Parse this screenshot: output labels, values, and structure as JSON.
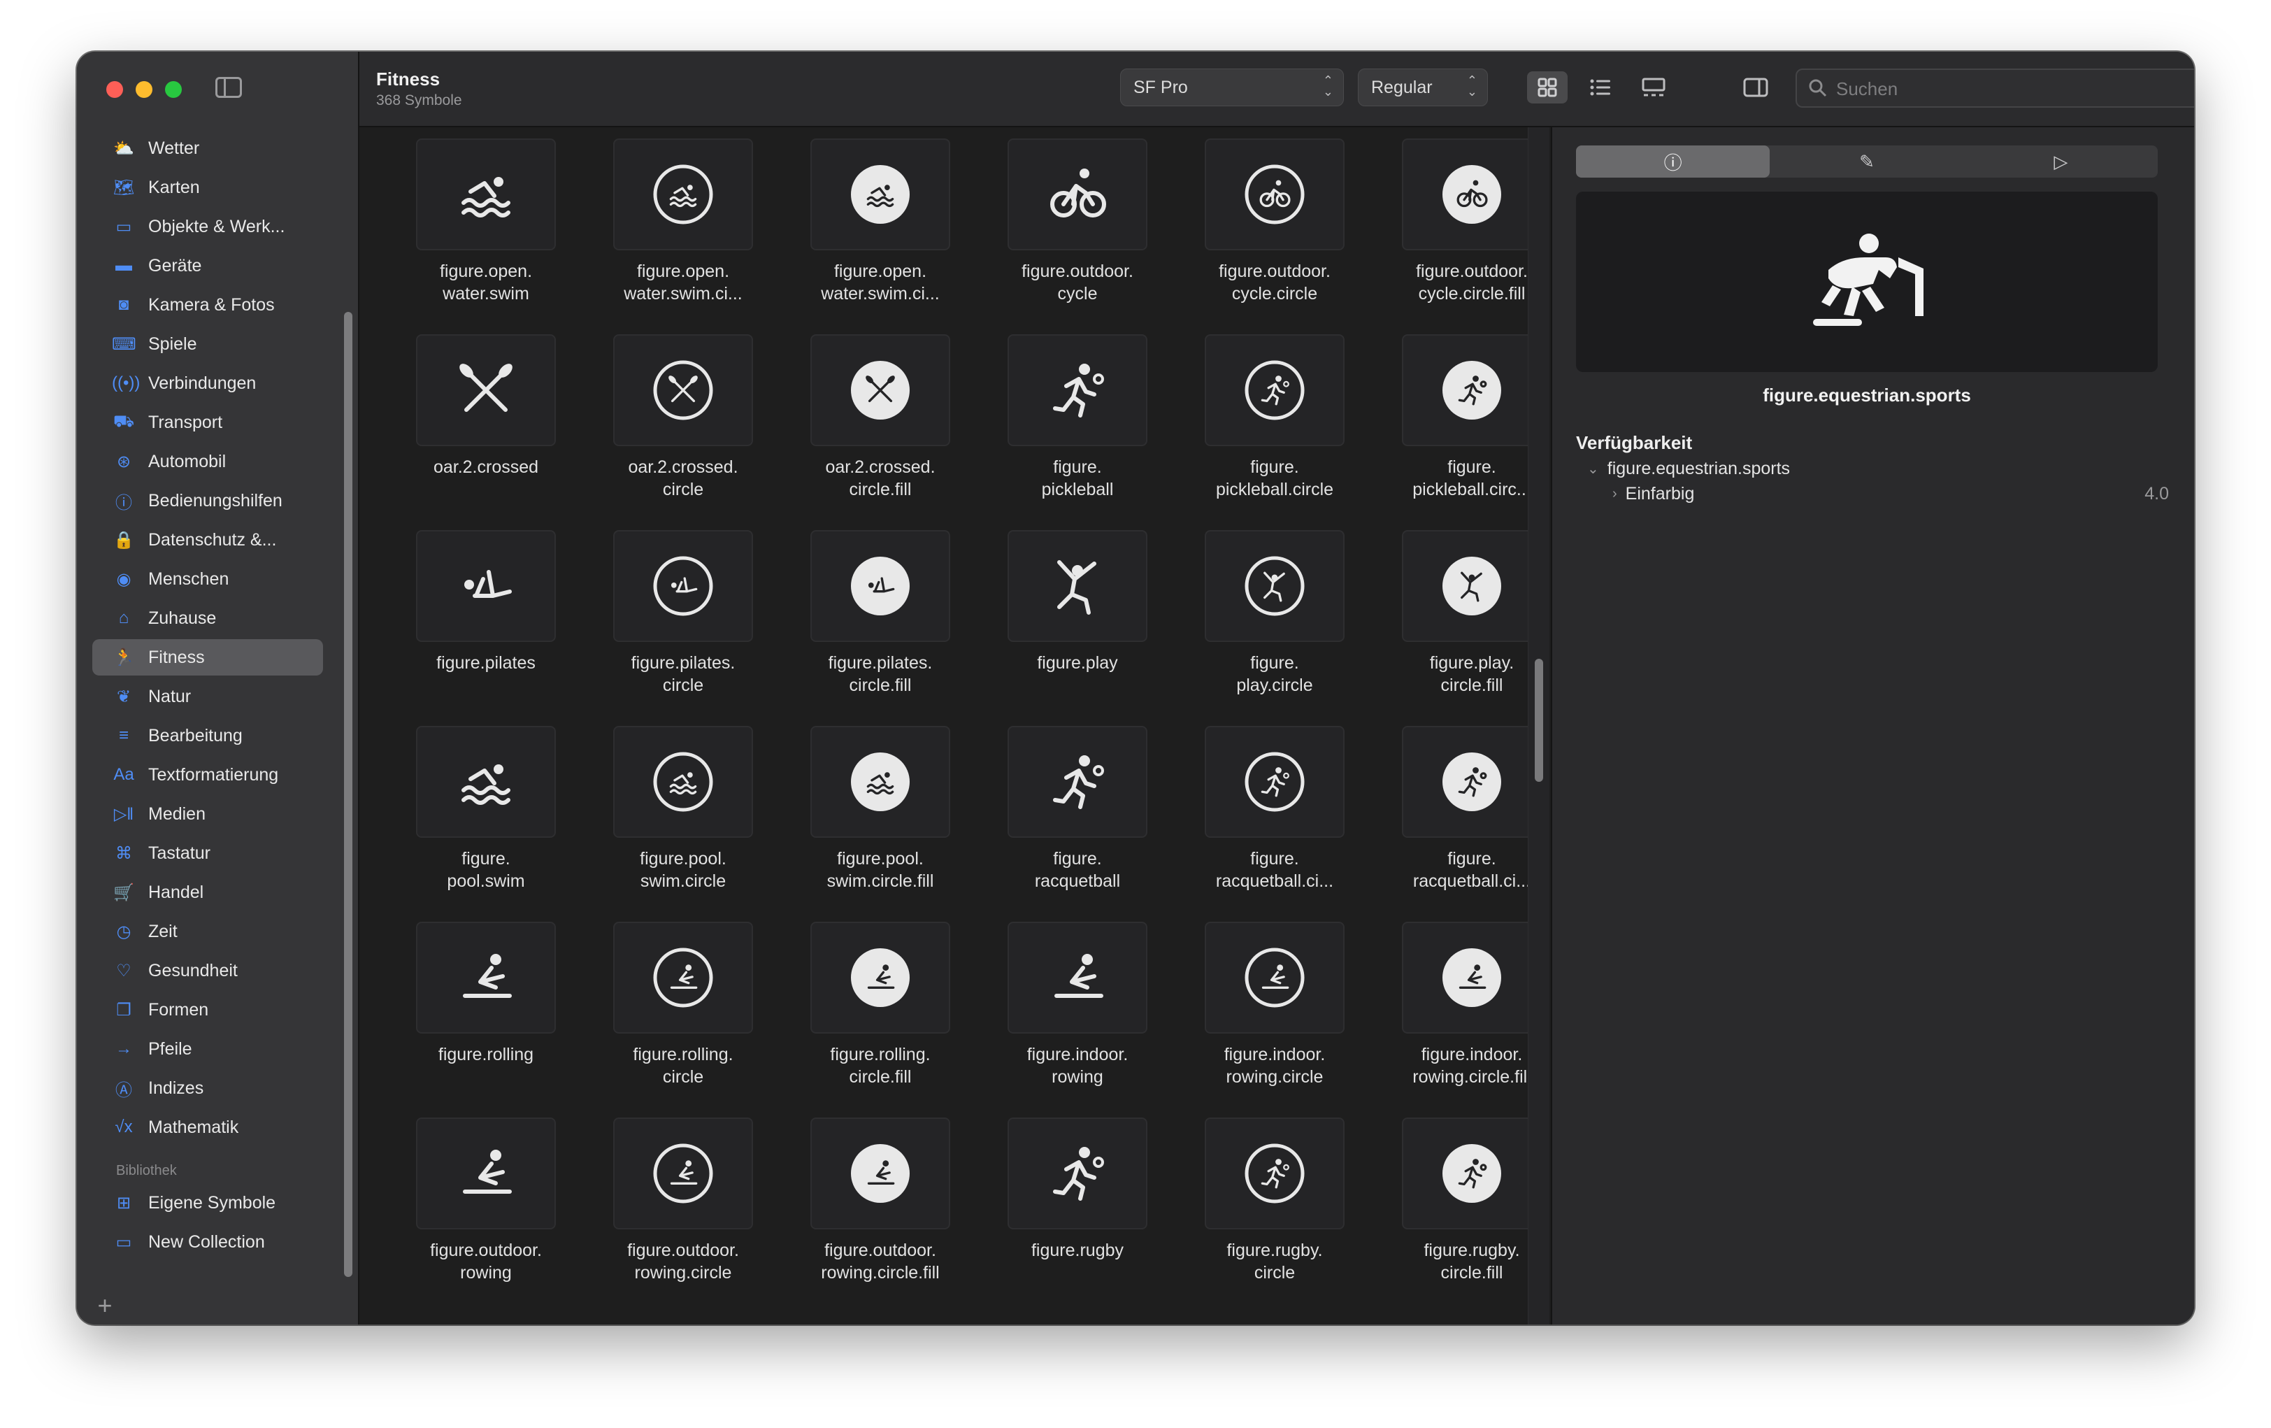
{
  "sidebar": {
    "items": [
      {
        "label": "Wetter",
        "icon": "cloud-sun-icon",
        "glyph": "⛅"
      },
      {
        "label": "Karten",
        "icon": "map-icon",
        "glyph": "🗺"
      },
      {
        "label": "Objekte & Werk...",
        "icon": "folder-icon",
        "glyph": "▭"
      },
      {
        "label": "Geräte",
        "icon": "display-icon",
        "glyph": "▬"
      },
      {
        "label": "Kamera & Fotos",
        "icon": "camera-icon",
        "glyph": "◙"
      },
      {
        "label": "Spiele",
        "icon": "gamecontroller-icon",
        "glyph": "⌨"
      },
      {
        "label": "Verbindungen",
        "icon": "antenna-icon",
        "glyph": "((•))"
      },
      {
        "label": "Transport",
        "icon": "car-icon",
        "glyph": "⛟"
      },
      {
        "label": "Automobil",
        "icon": "steering-wheel-icon",
        "glyph": "⊛"
      },
      {
        "label": "Bedienungshilfen",
        "icon": "accessibility-icon",
        "glyph": "ⓘ"
      },
      {
        "label": "Datenschutz &...",
        "icon": "lock-icon",
        "glyph": "🔒"
      },
      {
        "label": "Menschen",
        "icon": "person-circle-icon",
        "glyph": "◉"
      },
      {
        "label": "Zuhause",
        "icon": "house-icon",
        "glyph": "⌂"
      },
      {
        "label": "Fitness",
        "icon": "figure-run-icon",
        "glyph": "🏃",
        "active": true
      },
      {
        "label": "Natur",
        "icon": "leaf-icon",
        "glyph": "❦"
      },
      {
        "label": "Bearbeitung",
        "icon": "sliders-icon",
        "glyph": "≡"
      },
      {
        "label": "Textformatierung",
        "icon": "textformat-icon",
        "glyph": "Aa"
      },
      {
        "label": "Medien",
        "icon": "playpause-icon",
        "glyph": "▷‖"
      },
      {
        "label": "Tastatur",
        "icon": "command-icon",
        "glyph": "⌘"
      },
      {
        "label": "Handel",
        "icon": "cart-icon",
        "glyph": "🛒"
      },
      {
        "label": "Zeit",
        "icon": "clock-icon",
        "glyph": "◷"
      },
      {
        "label": "Gesundheit",
        "icon": "heart-icon",
        "glyph": "♡"
      },
      {
        "label": "Formen",
        "icon": "square-on-square-icon",
        "glyph": "❐"
      },
      {
        "label": "Pfeile",
        "icon": "arrow-right-icon",
        "glyph": "→"
      },
      {
        "label": "Indizes",
        "icon": "a-circle-icon",
        "glyph": "Ⓐ"
      },
      {
        "label": "Mathematik",
        "icon": "function-icon",
        "glyph": "√x"
      }
    ],
    "library_title": "Bibliothek",
    "library_items": [
      {
        "label": "Eigene Symbole",
        "icon": "square-grid-icon",
        "glyph": "⊞"
      },
      {
        "label": "New Collection",
        "icon": "folder-icon",
        "glyph": "▭"
      }
    ],
    "add_label": "+"
  },
  "toolbar": {
    "title": "Fitness",
    "subtitle": "368 Symbole",
    "font_popup": "SF Pro",
    "weight_popup": "Regular",
    "search_placeholder": "Suchen"
  },
  "symbols": [
    {
      "label": "figure.open.\nwater.swim",
      "kind": "swim",
      "variant": "plain"
    },
    {
      "label": "figure.open.\nwater.swim.ci...",
      "kind": "swim",
      "variant": "circle"
    },
    {
      "label": "figure.open.\nwater.swim.ci...",
      "kind": "swim",
      "variant": "fill"
    },
    {
      "label": "figure.outdoor.\ncycle",
      "kind": "cycle",
      "variant": "plain"
    },
    {
      "label": "figure.outdoor.\ncycle.circle",
      "kind": "cycle",
      "variant": "circle"
    },
    {
      "label": "figure.outdoor.\ncycle.circle.fill",
      "kind": "cycle",
      "variant": "fill"
    },
    {
      "label": "oar.2.crossed",
      "kind": "oars",
      "variant": "plain"
    },
    {
      "label": "oar.2.crossed.\ncircle",
      "kind": "oars",
      "variant": "circle"
    },
    {
      "label": "oar.2.crossed.\ncircle.fill",
      "kind": "oars",
      "variant": "fill"
    },
    {
      "label": "figure.\npickleball",
      "kind": "run",
      "variant": "plain"
    },
    {
      "label": "figure.\npickleball.circle",
      "kind": "run",
      "variant": "circle"
    },
    {
      "label": "figure.\npickleball.circ...",
      "kind": "run",
      "variant": "fill"
    },
    {
      "label": "figure.pilates",
      "kind": "pilates",
      "variant": "plain"
    },
    {
      "label": "figure.pilates.\ncircle",
      "kind": "pilates",
      "variant": "circle"
    },
    {
      "label": "figure.pilates.\ncircle.fill",
      "kind": "pilates",
      "variant": "fill"
    },
    {
      "label": "figure.play",
      "kind": "play",
      "variant": "plain"
    },
    {
      "label": "figure.\nplay.circle",
      "kind": "play",
      "variant": "circle"
    },
    {
      "label": "figure.play.\ncircle.fill",
      "kind": "play",
      "variant": "fill"
    },
    {
      "label": "figure.\npool.swim",
      "kind": "swim",
      "variant": "plain"
    },
    {
      "label": "figure.pool.\nswim.circle",
      "kind": "swim",
      "variant": "circle"
    },
    {
      "label": "figure.pool.\nswim.circle.fill",
      "kind": "swim",
      "variant": "fill"
    },
    {
      "label": "figure.\nracquetball",
      "kind": "run",
      "variant": "plain"
    },
    {
      "label": "figure.\nracquetball.ci...",
      "kind": "run",
      "variant": "circle"
    },
    {
      "label": "figure.\nracquetball.ci...",
      "kind": "run",
      "variant": "fill"
    },
    {
      "label": "figure.rolling",
      "kind": "rowing",
      "variant": "plain"
    },
    {
      "label": "figure.rolling.\ncircle",
      "kind": "rowing",
      "variant": "circle"
    },
    {
      "label": "figure.rolling.\ncircle.fill",
      "kind": "rowing",
      "variant": "fill"
    },
    {
      "label": "figure.indoor.\nrowing",
      "kind": "rowing",
      "variant": "plain"
    },
    {
      "label": "figure.indoor.\nrowing.circle",
      "kind": "rowing",
      "variant": "circle"
    },
    {
      "label": "figure.indoor.\nrowing.circle.fill",
      "kind": "rowing",
      "variant": "fill"
    },
    {
      "label": "figure.outdoor.\nrowing",
      "kind": "rowing",
      "variant": "plain"
    },
    {
      "label": "figure.outdoor.\nrowing.circle",
      "kind": "rowing",
      "variant": "circle"
    },
    {
      "label": "figure.outdoor.\nrowing.circle.fill",
      "kind": "rowing",
      "variant": "fill"
    },
    {
      "label": "figure.rugby",
      "kind": "run",
      "variant": "plain"
    },
    {
      "label": "figure.rugby.\ncircle",
      "kind": "run",
      "variant": "circle"
    },
    {
      "label": "figure.rugby.\ncircle.fill",
      "kind": "run",
      "variant": "fill"
    }
  ],
  "inspector": {
    "tabs": [
      {
        "name": "info-icon",
        "glyph": "ⓘ",
        "active": true
      },
      {
        "name": "paintbrush-icon",
        "glyph": "✎",
        "active": false
      },
      {
        "name": "play-icon",
        "glyph": "▷",
        "active": false
      }
    ],
    "selected_name": "figure.equestrian.sports",
    "availability_title": "Verfügbarkeit",
    "availability_symbol": "figure.equestrian.sports",
    "rendering_mode": "Einfarbig",
    "version": "4.0"
  },
  "colors": {
    "accent": "#4f8df5",
    "sidebar_bg": "#353537",
    "grid_bg": "#1e1e1e",
    "tile_bg": "#242426"
  }
}
